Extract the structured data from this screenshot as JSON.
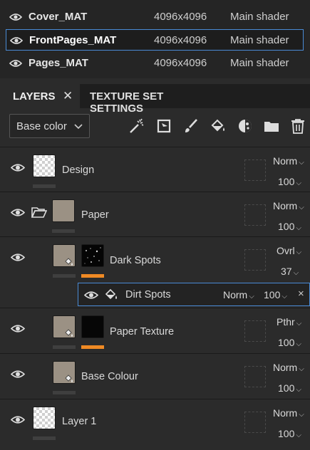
{
  "texture_sets": [
    {
      "name": "Cover_MAT",
      "resolution": "4096x4096",
      "shader": "Main shader",
      "selected": false
    },
    {
      "name": "FrontPages_MAT",
      "resolution": "4096x4096",
      "shader": "Main shader",
      "selected": true
    },
    {
      "name": "Pages_MAT",
      "resolution": "4096x4096",
      "shader": "Main shader",
      "selected": false
    }
  ],
  "tabs": {
    "layers": "LAYERS",
    "close": "✕",
    "texture_set_settings": "TEXTURE SET SETTINGS"
  },
  "toolbar": {
    "channel": "Base color",
    "icons": [
      "magic-wand-icon",
      "add-fill-icon",
      "brush-icon",
      "paint-bucket-icon",
      "mask-icon",
      "folder-icon",
      "trash-icon"
    ]
  },
  "layers": [
    {
      "name": "Design",
      "blend": "Norm",
      "opacity": "100"
    },
    {
      "name": "Paper",
      "blend": "Norm",
      "opacity": "100"
    },
    {
      "name": "Dark Spots",
      "blend": "Ovrl",
      "opacity": "37"
    },
    {
      "name": "Paper Texture",
      "blend": "Pthr",
      "opacity": "100"
    },
    {
      "name": "Base Colour",
      "blend": "Norm",
      "opacity": "100"
    },
    {
      "name": "Layer 1",
      "blend": "Norm",
      "opacity": "100"
    }
  ],
  "effect": {
    "name": "Dirt Spots",
    "blend": "Norm",
    "opacity": "100",
    "close": "×"
  },
  "colors": {
    "accent_blue": "#4a8bd6",
    "mask_orange": "#f08a24",
    "panel_bg": "#2b2b2b"
  }
}
